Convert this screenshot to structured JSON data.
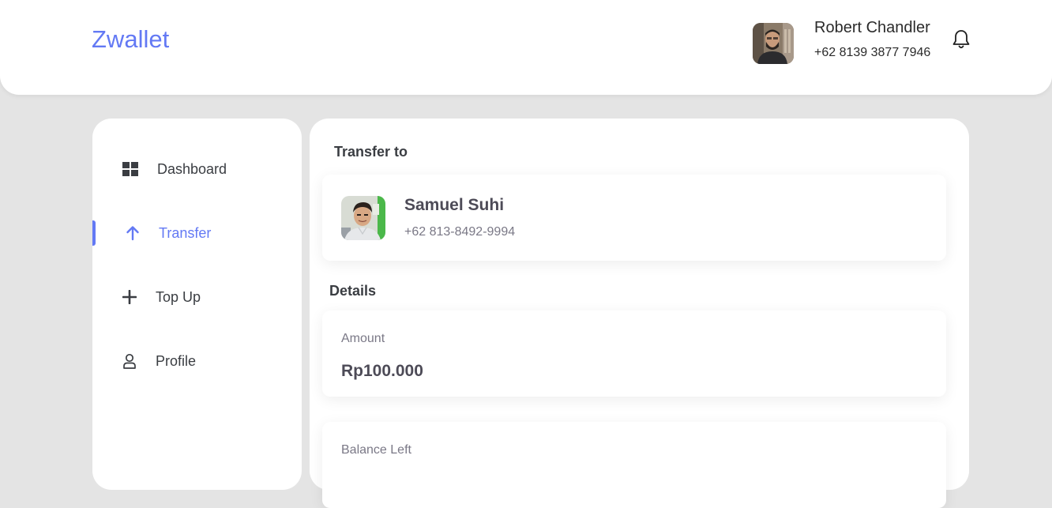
{
  "app": {
    "brand": "Zwallet",
    "accent_color": "#6379f4"
  },
  "header": {
    "user_name": "Robert Chandler",
    "user_phone": "+62 8139 3877 7946",
    "notification_icon": "bell-icon"
  },
  "sidebar": {
    "items": [
      {
        "label": "Dashboard",
        "icon": "dashboard-grid-icon",
        "active": false
      },
      {
        "label": "Transfer",
        "icon": "arrow-up-icon",
        "active": true
      },
      {
        "label": "Top Up",
        "icon": "plus-icon",
        "active": false
      },
      {
        "label": "Profile",
        "icon": "user-icon",
        "active": false
      }
    ]
  },
  "main": {
    "transfer_title": "Transfer to",
    "recipient": {
      "name": "Samuel Suhi",
      "phone": "+62 813-8492-9994"
    },
    "details_title": "Details",
    "details": [
      {
        "label": "Amount",
        "value": "Rp100.000"
      },
      {
        "label": "Balance Left",
        "value": ""
      }
    ]
  }
}
